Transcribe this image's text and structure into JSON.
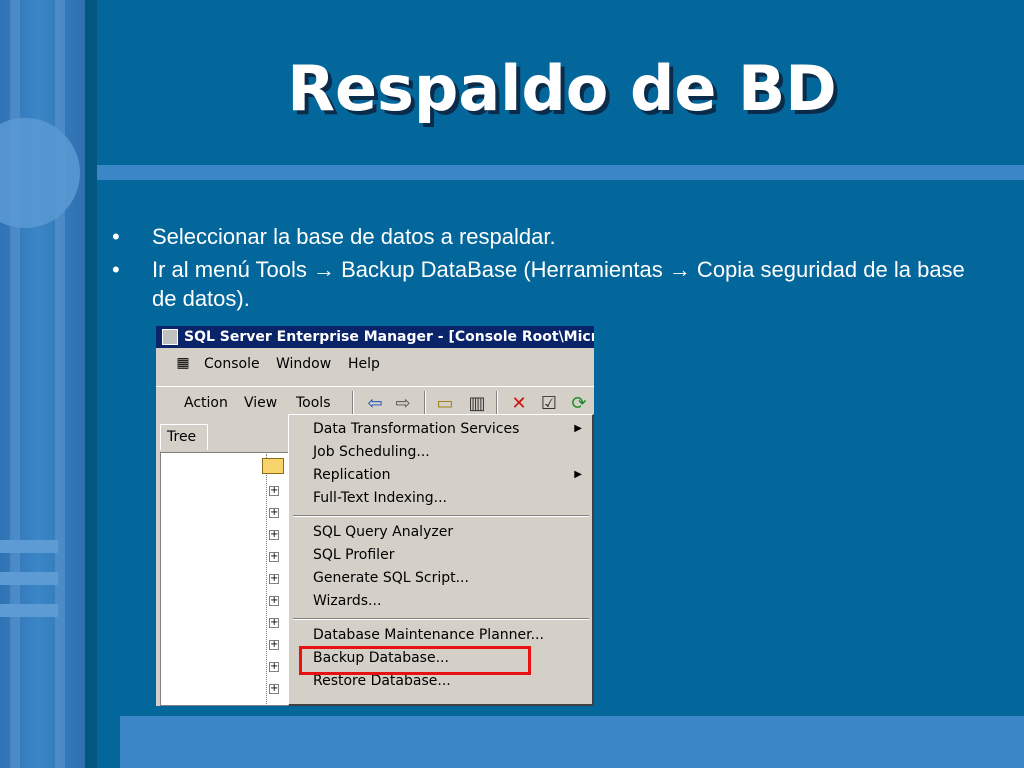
{
  "slide": {
    "title": "Respaldo de BD",
    "bullets": [
      {
        "marker": "•",
        "text": "Seleccionar la base de datos a respaldar."
      },
      {
        "marker": "•",
        "text": "Ir al menú Tools → Backup DataBase (Herramientas → Copia seguridad de la base de datos)."
      }
    ],
    "colors": {
      "background": "#03679b",
      "accent": "#3a86c7",
      "highlight": "#e81010"
    }
  },
  "window": {
    "title": "SQL Server Enterprise Manager - [Console Root\\Micros",
    "menu": {
      "console": "Console",
      "window": "Window",
      "help": "Help"
    },
    "toolbar": {
      "action": "Action",
      "view": "View",
      "tools": "Tools"
    },
    "icons": [
      "back-arrow-icon",
      "forward-arrow-icon",
      "up-folder-icon",
      "show-tree-icon",
      "delete-icon",
      "properties-icon",
      "refresh-icon"
    ],
    "tree_tab": "Tree",
    "tools_menu": [
      {
        "label": "Data Transformation Services",
        "submenu": true
      },
      {
        "label": "Job Scheduling...",
        "submenu": false
      },
      {
        "label": "Replication",
        "submenu": true
      },
      {
        "label": "Full-Text Indexing...",
        "submenu": false
      },
      {
        "label": "SQL Query Analyzer",
        "submenu": false
      },
      {
        "label": "SQL Profiler",
        "submenu": false
      },
      {
        "label": "Generate SQL Script...",
        "submenu": false
      },
      {
        "label": "Wizards...",
        "submenu": false
      },
      {
        "label": "Database Maintenance Planner...",
        "submenu": false
      },
      {
        "label": "Backup Database...",
        "submenu": false
      },
      {
        "label": "Restore Database...",
        "submenu": false
      }
    ]
  }
}
